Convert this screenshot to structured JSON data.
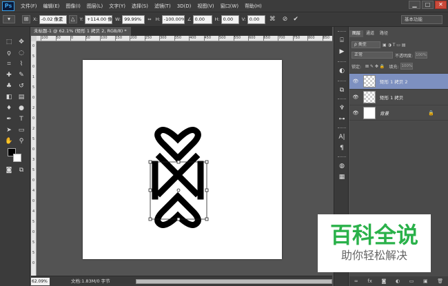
{
  "app": {
    "logo": "Ps"
  },
  "menu": [
    "文件(F)",
    "编辑(E)",
    "图像(I)",
    "图层(L)",
    "文字(Y)",
    "选择(S)",
    "滤镜(T)",
    "3D(D)",
    "视图(V)",
    "窗口(W)",
    "帮助(H)"
  ],
  "window_controls": {
    "minimize": "▁",
    "maximize": "□",
    "close": "✕"
  },
  "options": {
    "x_label": "X:",
    "x_value": "-0.02 像素",
    "y_label": "Y:",
    "y_value": "+114.00 像",
    "w_label": "W:",
    "w_value": "99.99%",
    "h_label": "H:",
    "h_value": "-100.00%",
    "rotate_value": "0.00",
    "hskew_label": "H:",
    "hskew_value": "0.00",
    "vskew_label": "V:",
    "vskew_value": "0.00",
    "workspace": "基本功能"
  },
  "document": {
    "tab_title": "未标题-1 @ 62.1% (矩形 1 拷贝 2, RGB/8) *",
    "zoom": "62.09%",
    "info": "文档:1.83M/0 字节"
  },
  "ruler": {
    "top_ticks": [
      "100",
      "50",
      "0",
      "50",
      "100",
      "150",
      "200",
      "250",
      "300",
      "350",
      "400",
      "450",
      "500",
      "550",
      "600",
      "650",
      "700",
      "750",
      "800",
      "850"
    ],
    "left_ticks": [
      "0",
      "5",
      "0",
      "1",
      "5",
      "0",
      "2",
      "0",
      "2",
      "5",
      "0",
      "3",
      "5",
      "0",
      "4",
      "0",
      "4",
      "5",
      "0",
      "5",
      "5",
      "0"
    ]
  },
  "layers_panel": {
    "tabs": [
      "图层",
      "通道",
      "路径"
    ],
    "kind_filter": "ρ 类型",
    "blend_mode": "正常",
    "opacity_label": "不透明度:",
    "opacity_value": "100%",
    "lock_label": "锁定:",
    "fill_label": "填充:",
    "fill_value": "100%",
    "layers": [
      {
        "name": "矩形 1 拷贝 2",
        "selected": true
      },
      {
        "name": "矩形 1 拷贝",
        "selected": false
      },
      {
        "name": "背景",
        "selected": false
      }
    ]
  },
  "watermark": {
    "title": "百科全说",
    "subtitle": "助你轻松解决"
  }
}
